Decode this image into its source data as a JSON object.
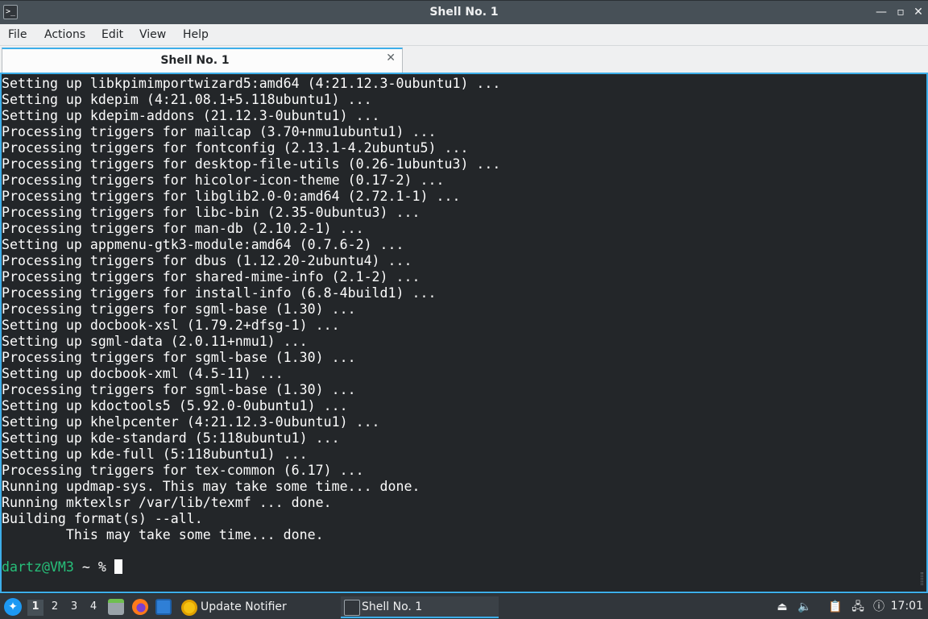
{
  "window": {
    "title": "Shell No. 1",
    "controls": {
      "minimize": "—",
      "restore": "▫",
      "close": "✕"
    }
  },
  "menubar": {
    "items": [
      "File",
      "Actions",
      "Edit",
      "View",
      "Help"
    ]
  },
  "tabs": [
    {
      "label": "Shell No. 1",
      "active": true
    }
  ],
  "terminal": {
    "lines": [
      "Setting up libkpimimportwizard5:amd64 (4:21.12.3-0ubuntu1) ...",
      "Setting up kdepim (4:21.08.1+5.118ubuntu1) ...",
      "Setting up kdepim-addons (21.12.3-0ubuntu1) ...",
      "Processing triggers for mailcap (3.70+nmu1ubuntu1) ...",
      "Processing triggers for fontconfig (2.13.1-4.2ubuntu5) ...",
      "Processing triggers for desktop-file-utils (0.26-1ubuntu3) ...",
      "Processing triggers for hicolor-icon-theme (0.17-2) ...",
      "Processing triggers for libglib2.0-0:amd64 (2.72.1-1) ...",
      "Processing triggers for libc-bin (2.35-0ubuntu3) ...",
      "Processing triggers for man-db (2.10.2-1) ...",
      "Setting up appmenu-gtk3-module:amd64 (0.7.6-2) ...",
      "Processing triggers for dbus (1.12.20-2ubuntu4) ...",
      "Processing triggers for shared-mime-info (2.1-2) ...",
      "Processing triggers for install-info (6.8-4build1) ...",
      "Processing triggers for sgml-base (1.30) ...",
      "Setting up docbook-xsl (1.79.2+dfsg-1) ...",
      "Setting up sgml-data (2.0.11+nmu1) ...",
      "Processing triggers for sgml-base (1.30) ...",
      "Setting up docbook-xml (4.5-11) ...",
      "Processing triggers for sgml-base (1.30) ...",
      "Setting up kdoctools5 (5.92.0-0ubuntu1) ...",
      "Setting up khelpcenter (4:21.12.3-0ubuntu1) ...",
      "Setting up kde-standard (5:118ubuntu1) ...",
      "Setting up kde-full (5:118ubuntu1) ...",
      "Processing triggers for tex-common (6.17) ...",
      "Running updmap-sys. This may take some time... done.",
      "Running mktexlsr /var/lib/texmf ... done.",
      "Building format(s) --all.",
      "        This may take some time... done.",
      ""
    ],
    "prompt": {
      "user_host": "dartz@VM3",
      "path_symbol": " ~ % "
    }
  },
  "taskbar": {
    "desktops": [
      "1",
      "2",
      "3",
      "4"
    ],
    "active_desktop": "1",
    "launchers": [
      "file-manager-icon",
      "firefox-icon",
      "desktop-icon"
    ],
    "tasks": [
      {
        "label": "Update Notifier",
        "icon": "update-notifier-icon",
        "active": false
      },
      {
        "label": "Shell No. 1",
        "icon": "terminal-icon",
        "active": true
      }
    ],
    "tray": [
      "eject-icon",
      "volume-icon",
      "clipboard-icon",
      "network-icon",
      "notification-icon"
    ],
    "clock": "17:01"
  },
  "colors": {
    "accent": "#3daee9",
    "prompt_user": "#27c07a",
    "terminal_bg": "#232629"
  }
}
